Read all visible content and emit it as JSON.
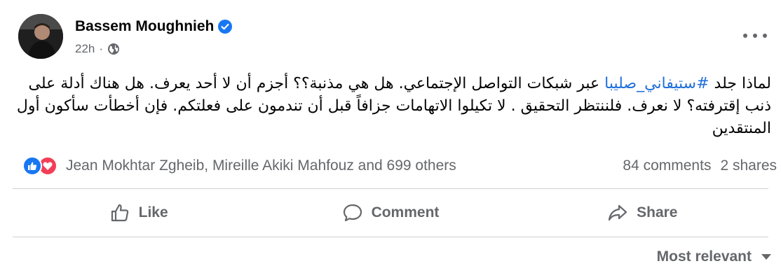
{
  "post": {
    "author": "Bassem Moughnieh",
    "time": "22h",
    "separator": "·",
    "hashtag": "#ستيفاني_صليبا",
    "text_before": "لماذا جلد ",
    "text_after": " عبر شبكات التواصل الإجتماعي. هل هي مذنبة؟؟ أجزم أن لا أحد يعرف. هل هناك أدلة على ذنب إقترفته؟ لا نعرف. فلننتظر التحقيق . لا تكيلوا الاتهامات جزافاً قبل أن تندمون على فعلتكم. فإن أخطأت سأكون أول المنتقدين"
  },
  "stats": {
    "reacted_by": "Jean Mokhtar Zgheib, Mireille Akiki Mahfouz and 699 others",
    "comments": "84 comments",
    "shares": "2 shares"
  },
  "actions": {
    "like": "Like",
    "comment": "Comment",
    "share": "Share"
  },
  "sort": {
    "label": "Most relevant"
  },
  "colors": {
    "hashtag": "#216fdb",
    "like": "#1877f2",
    "love": "#f33e58",
    "secondary_text": "#65676b"
  }
}
